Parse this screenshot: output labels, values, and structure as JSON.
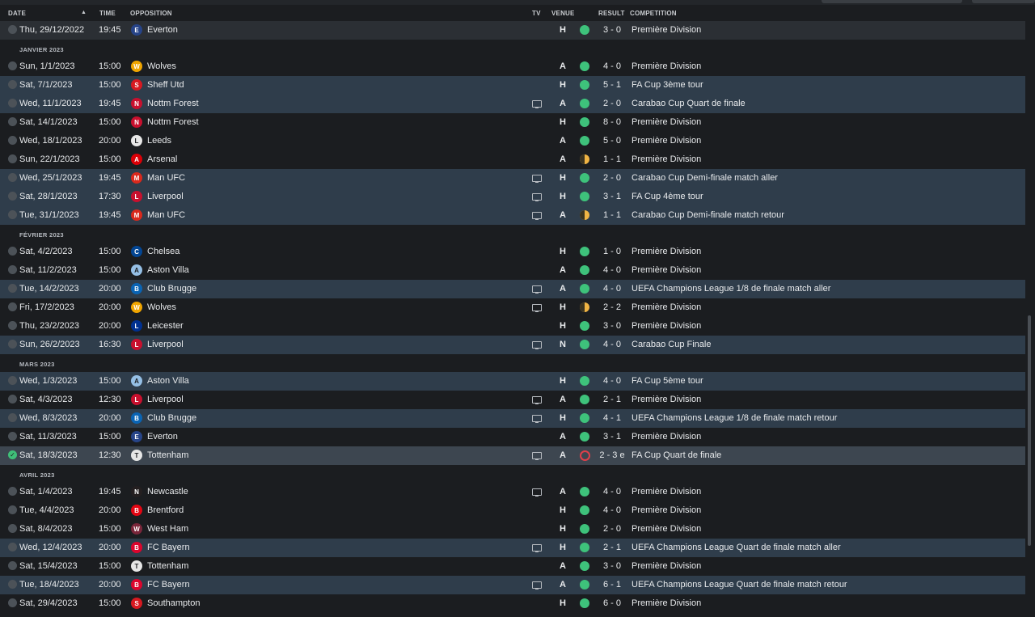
{
  "header": {
    "date": "DATE",
    "time": "TIME",
    "opposition": "OPPOSITION",
    "tv": "TV",
    "venue": "VENUE",
    "result": "RESULT",
    "competition": "COMPETITION"
  },
  "colors": {
    "win": "#3ec27b",
    "draw": "#f0b444",
    "loss": "#e0404a"
  },
  "rows": [
    {
      "kind": "match",
      "style": "light",
      "date": "Thu, 29/12/2022",
      "time": "19:45",
      "opp": "Everton",
      "crest": "#274488",
      "crest_text": "E",
      "tv": false,
      "venue": "H",
      "outcome": "win",
      "result": "3 - 0",
      "comp": "Première Division"
    },
    {
      "kind": "month",
      "label": "JANVIER 2023"
    },
    {
      "kind": "match",
      "style": "dark",
      "date": "Sun, 1/1/2023",
      "time": "15:00",
      "opp": "Wolves",
      "crest": "#f0a500",
      "crest_text": "W",
      "tv": false,
      "venue": "A",
      "outcome": "win",
      "result": "4 - 0",
      "comp": "Première Division"
    },
    {
      "kind": "match",
      "style": "cup",
      "date": "Sat, 7/1/2023",
      "time": "15:00",
      "opp": "Sheff Utd",
      "crest": "#d71921",
      "crest_text": "S",
      "tv": false,
      "venue": "H",
      "outcome": "win",
      "result": "5 - 1",
      "comp": "FA Cup 3ème tour"
    },
    {
      "kind": "match",
      "style": "cup",
      "date": "Wed, 11/1/2023",
      "time": "19:45",
      "opp": "Nottm Forest",
      "crest": "#c8102e",
      "crest_text": "N",
      "tv": true,
      "venue": "A",
      "outcome": "win",
      "result": "2 - 0",
      "comp": "Carabao Cup Quart de finale"
    },
    {
      "kind": "match",
      "style": "dark",
      "date": "Sat, 14/1/2023",
      "time": "15:00",
      "opp": "Nottm Forest",
      "crest": "#c8102e",
      "crest_text": "N",
      "tv": false,
      "venue": "H",
      "outcome": "win",
      "result": "8 - 0",
      "comp": "Première Division"
    },
    {
      "kind": "match",
      "style": "dark",
      "date": "Wed, 18/1/2023",
      "time": "20:00",
      "opp": "Leeds",
      "crest": "#e8e8e8",
      "crest_text": "L",
      "tv": false,
      "venue": "A",
      "outcome": "win",
      "result": "5 - 0",
      "comp": "Première Division"
    },
    {
      "kind": "match",
      "style": "dark",
      "date": "Sun, 22/1/2023",
      "time": "15:00",
      "opp": "Arsenal",
      "crest": "#db0007",
      "crest_text": "A",
      "tv": false,
      "venue": "A",
      "outcome": "draw",
      "result": "1 - 1",
      "comp": "Première Division"
    },
    {
      "kind": "match",
      "style": "cup",
      "date": "Wed, 25/1/2023",
      "time": "19:45",
      "opp": "Man UFC",
      "crest": "#da291c",
      "crest_text": "M",
      "tv": true,
      "venue": "H",
      "outcome": "win",
      "result": "2 - 0",
      "comp": "Carabao Cup Demi-finale match aller"
    },
    {
      "kind": "match",
      "style": "cup",
      "date": "Sat, 28/1/2023",
      "time": "17:30",
      "opp": "Liverpool",
      "crest": "#c8102e",
      "crest_text": "L",
      "tv": true,
      "venue": "H",
      "outcome": "win",
      "result": "3 - 1",
      "comp": "FA Cup 4ème tour"
    },
    {
      "kind": "match",
      "style": "cup",
      "date": "Tue, 31/1/2023",
      "time": "19:45",
      "opp": "Man UFC",
      "crest": "#da291c",
      "crest_text": "M",
      "tv": true,
      "venue": "A",
      "outcome": "draw",
      "result": "1 - 1",
      "comp": "Carabao Cup Demi-finale match retour"
    },
    {
      "kind": "month",
      "label": "FÉVRIER 2023"
    },
    {
      "kind": "match",
      "style": "dark",
      "date": "Sat, 4/2/2023",
      "time": "15:00",
      "opp": "Chelsea",
      "crest": "#034694",
      "crest_text": "C",
      "tv": false,
      "venue": "H",
      "outcome": "win",
      "result": "1 - 0",
      "comp": "Première Division"
    },
    {
      "kind": "match",
      "style": "dark",
      "date": "Sat, 11/2/2023",
      "time": "15:00",
      "opp": "Aston Villa",
      "crest": "#95bfe5",
      "crest_text": "A",
      "tv": false,
      "venue": "A",
      "outcome": "win",
      "result": "4 - 0",
      "comp": "Première Division"
    },
    {
      "kind": "match",
      "style": "cup",
      "date": "Tue, 14/2/2023",
      "time": "20:00",
      "opp": "Club Brugge",
      "crest": "#0a64b4",
      "crest_text": "B",
      "tv": true,
      "venue": "A",
      "outcome": "win",
      "result": "4 - 0",
      "comp": "UEFA Champions League 1/8 de finale match aller"
    },
    {
      "kind": "match",
      "style": "dark",
      "date": "Fri, 17/2/2023",
      "time": "20:00",
      "opp": "Wolves",
      "crest": "#f0a500",
      "crest_text": "W",
      "tv": true,
      "venue": "H",
      "outcome": "draw",
      "result": "2 - 2",
      "comp": "Première Division"
    },
    {
      "kind": "match",
      "style": "dark",
      "date": "Thu, 23/2/2023",
      "time": "20:00",
      "opp": "Leicester",
      "crest": "#003090",
      "crest_text": "L",
      "tv": false,
      "venue": "H",
      "outcome": "win",
      "result": "3 - 0",
      "comp": "Première Division"
    },
    {
      "kind": "match",
      "style": "cup",
      "date": "Sun, 26/2/2023",
      "time": "16:30",
      "opp": "Liverpool",
      "crest": "#c8102e",
      "crest_text": "L",
      "tv": true,
      "venue": "N",
      "outcome": "win",
      "result": "4 - 0",
      "comp": "Carabao Cup Finale"
    },
    {
      "kind": "month",
      "label": "MARS 2023"
    },
    {
      "kind": "match",
      "style": "cup",
      "date": "Wed, 1/3/2023",
      "time": "15:00",
      "opp": "Aston Villa",
      "crest": "#95bfe5",
      "crest_text": "A",
      "tv": false,
      "venue": "H",
      "outcome": "win",
      "result": "4 - 0",
      "comp": "FA Cup 5ème tour"
    },
    {
      "kind": "match",
      "style": "dark",
      "date": "Sat, 4/3/2023",
      "time": "12:30",
      "opp": "Liverpool",
      "crest": "#c8102e",
      "crest_text": "L",
      "tv": true,
      "venue": "A",
      "outcome": "win",
      "result": "2 - 1",
      "comp": "Première Division"
    },
    {
      "kind": "match",
      "style": "cup",
      "date": "Wed, 8/3/2023",
      "time": "20:00",
      "opp": "Club Brugge",
      "crest": "#0a64b4",
      "crest_text": "B",
      "tv": true,
      "venue": "H",
      "outcome": "win",
      "result": "4 - 1",
      "comp": "UEFA Champions League 1/8 de finale match retour"
    },
    {
      "kind": "match",
      "style": "dark",
      "date": "Sat, 11/3/2023",
      "time": "15:00",
      "opp": "Everton",
      "crest": "#274488",
      "crest_text": "E",
      "tv": false,
      "venue": "A",
      "outcome": "win",
      "result": "3 - 1",
      "comp": "Première Division"
    },
    {
      "kind": "match",
      "style": "sel",
      "date": "Sat, 18/3/2023",
      "time": "12:30",
      "opp": "Tottenham",
      "crest": "#e6e6e6",
      "crest_text": "T",
      "tv": true,
      "venue": "A",
      "outcome": "loss",
      "result": "2 - 3 e",
      "comp": "FA Cup Quart de finale",
      "done": true
    },
    {
      "kind": "month",
      "label": "AVRIL 2023"
    },
    {
      "kind": "match",
      "style": "dark",
      "date": "Sat, 1/4/2023",
      "time": "19:45",
      "opp": "Newcastle",
      "crest": "#241f20",
      "crest_text": "N",
      "tv": true,
      "venue": "A",
      "outcome": "win",
      "result": "4 - 0",
      "comp": "Première Division"
    },
    {
      "kind": "match",
      "style": "dark",
      "date": "Tue, 4/4/2023",
      "time": "20:00",
      "opp": "Brentford",
      "crest": "#e30613",
      "crest_text": "B",
      "tv": false,
      "venue": "H",
      "outcome": "win",
      "result": "4 - 0",
      "comp": "Première Division"
    },
    {
      "kind": "match",
      "style": "dark",
      "date": "Sat, 8/4/2023",
      "time": "15:00",
      "opp": "West Ham",
      "crest": "#7a263a",
      "crest_text": "W",
      "tv": false,
      "venue": "H",
      "outcome": "win",
      "result": "2 - 0",
      "comp": "Première Division"
    },
    {
      "kind": "match",
      "style": "cup",
      "date": "Wed, 12/4/2023",
      "time": "20:00",
      "opp": "FC Bayern",
      "crest": "#dc052d",
      "crest_text": "B",
      "tv": true,
      "venue": "H",
      "outcome": "win",
      "result": "2 - 1",
      "comp": "UEFA Champions League Quart de finale match aller"
    },
    {
      "kind": "match",
      "style": "dark",
      "date": "Sat, 15/4/2023",
      "time": "15:00",
      "opp": "Tottenham",
      "crest": "#e6e6e6",
      "crest_text": "T",
      "tv": false,
      "venue": "A",
      "outcome": "win",
      "result": "3 - 0",
      "comp": "Première Division"
    },
    {
      "kind": "match",
      "style": "cup",
      "date": "Tue, 18/4/2023",
      "time": "20:00",
      "opp": "FC Bayern",
      "crest": "#dc052d",
      "crest_text": "B",
      "tv": true,
      "venue": "A",
      "outcome": "win",
      "result": "6 - 1",
      "comp": "UEFA Champions League Quart de finale match retour"
    },
    {
      "kind": "match",
      "style": "dark",
      "date": "Sat, 29/4/2023",
      "time": "15:00",
      "opp": "Southampton",
      "crest": "#d71920",
      "crest_text": "S",
      "tv": false,
      "venue": "H",
      "outcome": "win",
      "result": "6 - 0",
      "comp": "Première Division"
    }
  ]
}
